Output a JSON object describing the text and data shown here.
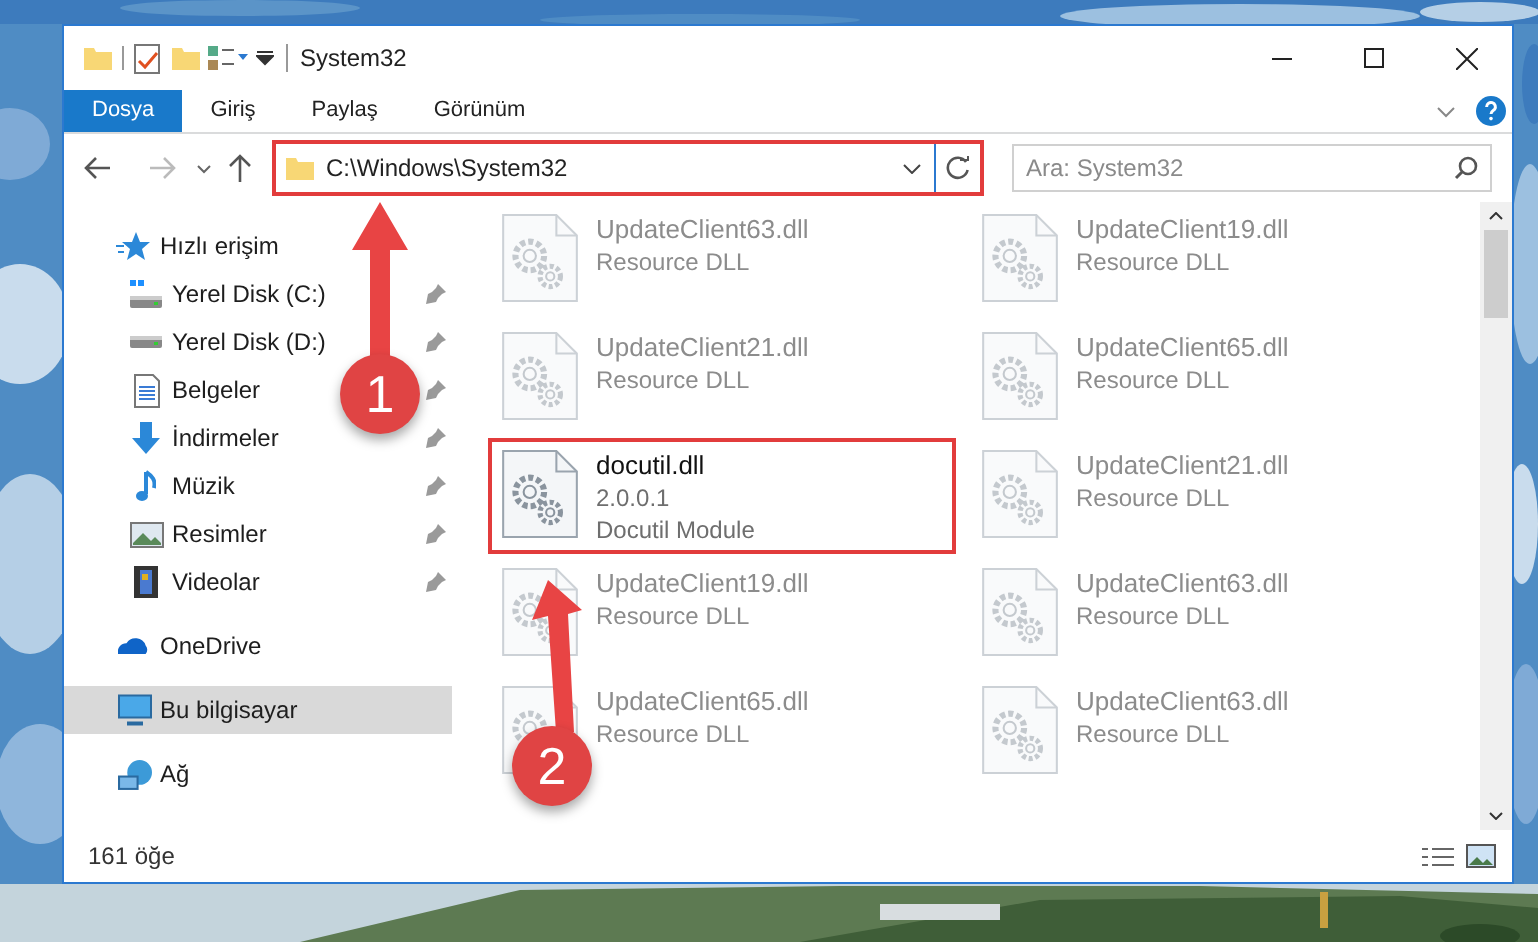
{
  "window": {
    "title": "System32"
  },
  "ribbon_tabs": [
    {
      "label": "Dosya",
      "selected": true
    },
    {
      "label": "Giriş",
      "selected": false
    },
    {
      "label": "Paylaş",
      "selected": false
    },
    {
      "label": "Görünüm",
      "selected": false
    }
  ],
  "address_bar": {
    "path": "C:\\Windows\\System32"
  },
  "search": {
    "placeholder": "Ara: System32"
  },
  "sidebar": {
    "items": [
      {
        "label": "Hızlı erişim",
        "kind": "quick",
        "selected": false,
        "children": [
          {
            "label": "Yerel Disk (C:)",
            "kind": "drive_c",
            "pinned": true
          },
          {
            "label": "Yerel Disk (D:)",
            "kind": "drive",
            "pinned": true
          },
          {
            "label": "Belgeler",
            "kind": "docs",
            "pinned": true
          },
          {
            "label": "İndirmeler",
            "kind": "download",
            "pinned": true
          },
          {
            "label": "Müzik",
            "kind": "music",
            "pinned": true
          },
          {
            "label": "Resimler",
            "kind": "pictures",
            "pinned": true
          },
          {
            "label": "Videolar",
            "kind": "videos",
            "pinned": true
          }
        ]
      },
      {
        "label": "OneDrive",
        "kind": "cloud",
        "selected": false
      },
      {
        "label": "Bu bilgisayar",
        "kind": "pc",
        "selected": true
      },
      {
        "label": "Ağ",
        "kind": "network",
        "selected": false
      }
    ]
  },
  "files": [
    {
      "name": "UpdateClient63.dll",
      "lines": [
        "Resource DLL"
      ],
      "blurred": true,
      "highlighted": false
    },
    {
      "name": "UpdateClient19.dll",
      "lines": [
        "Resource DLL"
      ],
      "blurred": true,
      "highlighted": false
    },
    {
      "name": "UpdateClient21.dll",
      "lines": [
        "Resource DLL"
      ],
      "blurred": true,
      "highlighted": false
    },
    {
      "name": "UpdateClient65.dll",
      "lines": [
        "Resource DLL"
      ],
      "blurred": true,
      "highlighted": false
    },
    {
      "name": "docutil.dll",
      "lines": [
        "2.0.0.1",
        "Docutil Module"
      ],
      "blurred": false,
      "highlighted": true
    },
    {
      "name": "UpdateClient21.dll",
      "lines": [
        "Resource DLL"
      ],
      "blurred": true,
      "highlighted": false
    },
    {
      "name": "UpdateClient19.dll",
      "lines": [
        "Resource DLL"
      ],
      "blurred": true,
      "highlighted": false
    },
    {
      "name": "UpdateClient63.dll",
      "lines": [
        "Resource DLL"
      ],
      "blurred": true,
      "highlighted": false
    },
    {
      "name": "UpdateClient65.dll",
      "lines": [
        "Resource DLL"
      ],
      "blurred": true,
      "highlighted": false
    },
    {
      "name": "UpdateClient63.dll",
      "lines": [
        "Resource DLL"
      ],
      "blurred": true,
      "highlighted": false
    }
  ],
  "callouts": [
    {
      "label": "1",
      "kind": "address"
    },
    {
      "label": "2",
      "kind": "file"
    }
  ],
  "status_bar": {
    "count": "161 öğe"
  }
}
